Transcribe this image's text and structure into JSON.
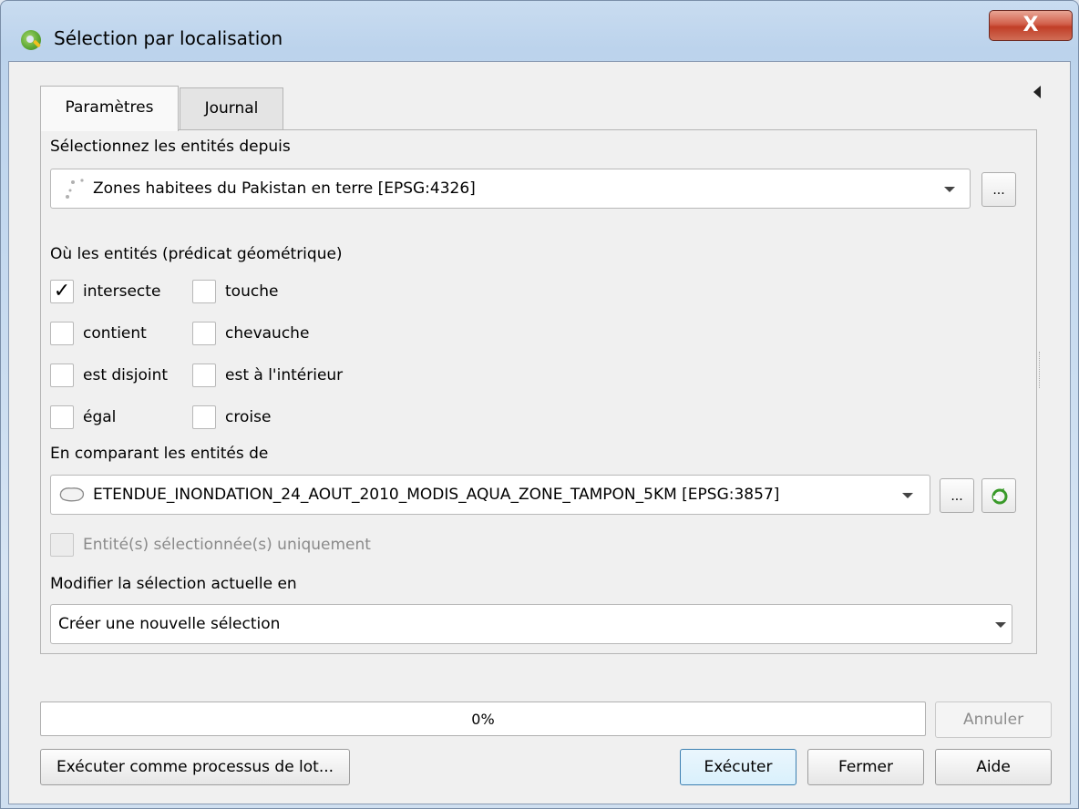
{
  "window": {
    "title": "Sélection par localisation",
    "close_label": "X"
  },
  "tabs": [
    {
      "label": "Paramètres",
      "active": true
    },
    {
      "label": "Journal",
      "active": false
    }
  ],
  "form": {
    "source_label": "Sélectionnez les entités depuis",
    "source_layer": "Zones habitees du Pakistan en terre [EPSG:4326]",
    "source_icon": "point-layer-icon",
    "more_button": "...",
    "predicate_label": "Où les entités (prédicat géométrique)",
    "predicates": [
      {
        "label": "intersecte",
        "checked": true
      },
      {
        "label": "touche",
        "checked": false
      },
      {
        "label": "contient",
        "checked": false
      },
      {
        "label": "chevauche",
        "checked": false
      },
      {
        "label": "est disjoint",
        "checked": false
      },
      {
        "label": "est à l'intérieur",
        "checked": false
      },
      {
        "label": "égal",
        "checked": false
      },
      {
        "label": "croise",
        "checked": false
      }
    ],
    "compare_label": "En comparant les entités de",
    "compare_layer": "ETENDUE_INONDATION_24_AOUT_2010_MODIS_AQUA_ZONE_TAMPON_5KM [EPSG:3857]",
    "compare_icon": "polygon-layer-icon",
    "iterate_icon": "green-refresh-icon",
    "selected_only_label": "Entité(s) sélectionnée(s) uniquement",
    "selected_only_checked": false,
    "modify_label": "Modifier la sélection actuelle en",
    "modify_value": "Créer une nouvelle sélection"
  },
  "progress": {
    "text": "0%",
    "value": 0
  },
  "buttons": {
    "cancel": "Annuler",
    "batch": "Exécuter comme processus de lot...",
    "run": "Exécuter",
    "close": "Fermer",
    "help": "Aide"
  }
}
